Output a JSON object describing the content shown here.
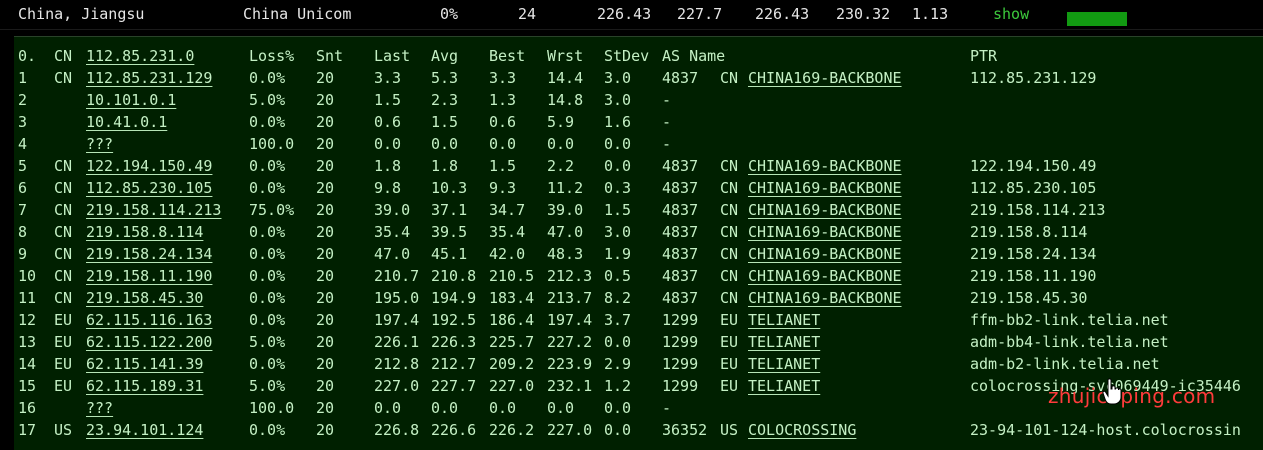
{
  "header": {
    "location": "China, Jiangsu",
    "isp": "China Unicom",
    "loss": "0%",
    "sent": "24",
    "last": "226.43",
    "avg": "227.7",
    "best": "226.43",
    "worst": "230.32",
    "stdev": "1.13",
    "show_label": "show",
    "bar_color": "#129a12"
  },
  "columns": {
    "hop": "0.",
    "cc": "CN",
    "host": "112.85.231.0",
    "loss": "Loss%",
    "snt": "Snt",
    "last": "Last",
    "avg": "Avg",
    "best": "Best",
    "wrst": "Wrst",
    "stdev": "StDev",
    "as_name": "AS Name",
    "ptr": "PTR"
  },
  "hops": [
    {
      "hop": "1",
      "cc": "CN",
      "host": "112.85.231.129",
      "loss": "0.0%",
      "snt": "20",
      "last": "3.3",
      "avg": "5.3",
      "best": "3.3",
      "wrst": "14.4",
      "stdev": "3.0",
      "as_num": "4837",
      "as_cc": "CN",
      "as_name": "CHINA169-BACKBONE",
      "ptr": "112.85.231.129"
    },
    {
      "hop": "2",
      "cc": "",
      "host": "10.101.0.1",
      "loss": "5.0%",
      "snt": "20",
      "last": "1.5",
      "avg": "2.3",
      "best": "1.3",
      "wrst": "14.8",
      "stdev": "3.0",
      "as_num": "-",
      "as_cc": "",
      "as_name": "",
      "ptr": ""
    },
    {
      "hop": "3",
      "cc": "",
      "host": "10.41.0.1",
      "loss": "0.0%",
      "snt": "20",
      "last": "0.6",
      "avg": "1.5",
      "best": "0.6",
      "wrst": "5.9",
      "stdev": "1.6",
      "as_num": "-",
      "as_cc": "",
      "as_name": "",
      "ptr": ""
    },
    {
      "hop": "4",
      "cc": "",
      "host": "???",
      "loss": "100.0",
      "snt": "20",
      "last": "0.0",
      "avg": "0.0",
      "best": "0.0",
      "wrst": "0.0",
      "stdev": "0.0",
      "as_num": "-",
      "as_cc": "",
      "as_name": "",
      "ptr": ""
    },
    {
      "hop": "5",
      "cc": "CN",
      "host": "122.194.150.49",
      "loss": "0.0%",
      "snt": "20",
      "last": "1.8",
      "avg": "1.8",
      "best": "1.5",
      "wrst": "2.2",
      "stdev": "0.0",
      "as_num": "4837",
      "as_cc": "CN",
      "as_name": "CHINA169-BACKBONE",
      "ptr": "122.194.150.49"
    },
    {
      "hop": "6",
      "cc": "CN",
      "host": "112.85.230.105",
      "loss": "0.0%",
      "snt": "20",
      "last": "9.8",
      "avg": "10.3",
      "best": "9.3",
      "wrst": "11.2",
      "stdev": "0.3",
      "as_num": "4837",
      "as_cc": "CN",
      "as_name": "CHINA169-BACKBONE",
      "ptr": "112.85.230.105"
    },
    {
      "hop": "7",
      "cc": "CN",
      "host": "219.158.114.213",
      "loss": "75.0%",
      "snt": "20",
      "last": "39.0",
      "avg": "37.1",
      "best": "34.7",
      "wrst": "39.0",
      "stdev": "1.5",
      "as_num": "4837",
      "as_cc": "CN",
      "as_name": "CHINA169-BACKBONE",
      "ptr": "219.158.114.213"
    },
    {
      "hop": "8",
      "cc": "CN",
      "host": "219.158.8.114",
      "loss": "0.0%",
      "snt": "20",
      "last": "35.4",
      "avg": "39.5",
      "best": "35.4",
      "wrst": "47.0",
      "stdev": "3.0",
      "as_num": "4837",
      "as_cc": "CN",
      "as_name": "CHINA169-BACKBONE",
      "ptr": "219.158.8.114"
    },
    {
      "hop": "9",
      "cc": "CN",
      "host": "219.158.24.134",
      "loss": "0.0%",
      "snt": "20",
      "last": "47.0",
      "avg": "45.1",
      "best": "42.0",
      "wrst": "48.3",
      "stdev": "1.9",
      "as_num": "4837",
      "as_cc": "CN",
      "as_name": "CHINA169-BACKBONE",
      "ptr": "219.158.24.134"
    },
    {
      "hop": "10",
      "cc": "CN",
      "host": "219.158.11.190",
      "loss": "0.0%",
      "snt": "20",
      "last": "210.7",
      "avg": "210.8",
      "best": "210.5",
      "wrst": "212.3",
      "stdev": "0.5",
      "as_num": "4837",
      "as_cc": "CN",
      "as_name": "CHINA169-BACKBONE",
      "ptr": "219.158.11.190"
    },
    {
      "hop": "11",
      "cc": "CN",
      "host": "219.158.45.30",
      "loss": "0.0%",
      "snt": "20",
      "last": "195.0",
      "avg": "194.9",
      "best": "183.4",
      "wrst": "213.7",
      "stdev": "8.2",
      "as_num": "4837",
      "as_cc": "CN",
      "as_name": "CHINA169-BACKBONE",
      "ptr": "219.158.45.30"
    },
    {
      "hop": "12",
      "cc": "EU",
      "host": "62.115.116.163",
      "loss": "0.0%",
      "snt": "20",
      "last": "197.4",
      "avg": "192.5",
      "best": "186.4",
      "wrst": "197.4",
      "stdev": "3.7",
      "as_num": "1299",
      "as_cc": "EU",
      "as_name": "TELIANET",
      "ptr": "ffm-bb2-link.telia.net"
    },
    {
      "hop": "13",
      "cc": "EU",
      "host": "62.115.122.200",
      "loss": "5.0%",
      "snt": "20",
      "last": "226.1",
      "avg": "226.3",
      "best": "225.7",
      "wrst": "227.2",
      "stdev": "0.0",
      "as_num": "1299",
      "as_cc": "EU",
      "as_name": "TELIANET",
      "ptr": "adm-bb4-link.telia.net"
    },
    {
      "hop": "14",
      "cc": "EU",
      "host": "62.115.141.39",
      "loss": "0.0%",
      "snt": "20",
      "last": "212.8",
      "avg": "212.7",
      "best": "209.2",
      "wrst": "223.9",
      "stdev": "2.9",
      "as_num": "1299",
      "as_cc": "EU",
      "as_name": "TELIANET",
      "ptr": "adm-b2-link.telia.net"
    },
    {
      "hop": "15",
      "cc": "EU",
      "host": "62.115.189.31",
      "loss": "5.0%",
      "snt": "20",
      "last": "227.0",
      "avg": "227.7",
      "best": "227.0",
      "wrst": "232.1",
      "stdev": "1.2",
      "as_num": "1299",
      "as_cc": "EU",
      "as_name": "TELIANET",
      "ptr": "colocrossing-svc069449-ic35446"
    },
    {
      "hop": "16",
      "cc": "",
      "host": "???",
      "loss": "100.0",
      "snt": "20",
      "last": "0.0",
      "avg": "0.0",
      "best": "0.0",
      "wrst": "0.0",
      "stdev": "0.0",
      "as_num": "-",
      "as_cc": "",
      "as_name": "",
      "ptr": ""
    },
    {
      "hop": "17",
      "cc": "US",
      "host": "23.94.101.124",
      "loss": "0.0%",
      "snt": "20",
      "last": "226.8",
      "avg": "226.6",
      "best": "226.2",
      "wrst": "227.0",
      "stdev": "0.0",
      "as_num": "36352",
      "as_cc": "US",
      "as_name": "COLOCROSSING",
      "ptr": "23-94-101-124-host.colocrossin"
    }
  ],
  "watermark": {
    "text": "zhujiceping.com",
    "color": "#ff3b3b"
  }
}
